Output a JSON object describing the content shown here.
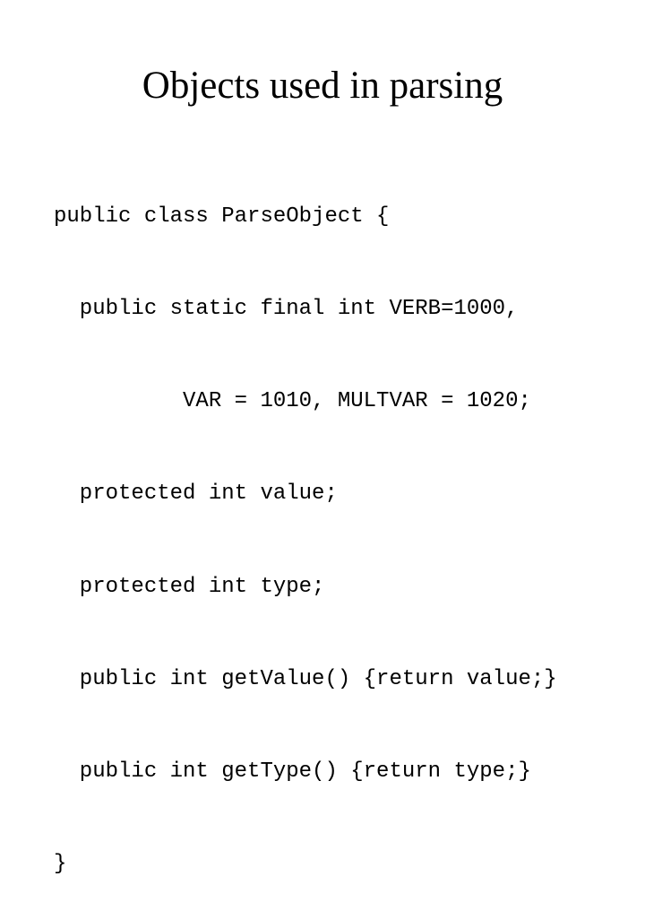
{
  "slide": {
    "title": "Objects used in parsing",
    "code_lines": [
      "public class ParseObject {",
      "  public static final int VERB=1000,",
      "          VAR = 1010, MULTVAR = 1020;",
      "  protected int value;",
      "  protected int type;",
      "  public int getValue() {return value;}",
      "  public int getType() {return type;}",
      "}"
    ]
  }
}
